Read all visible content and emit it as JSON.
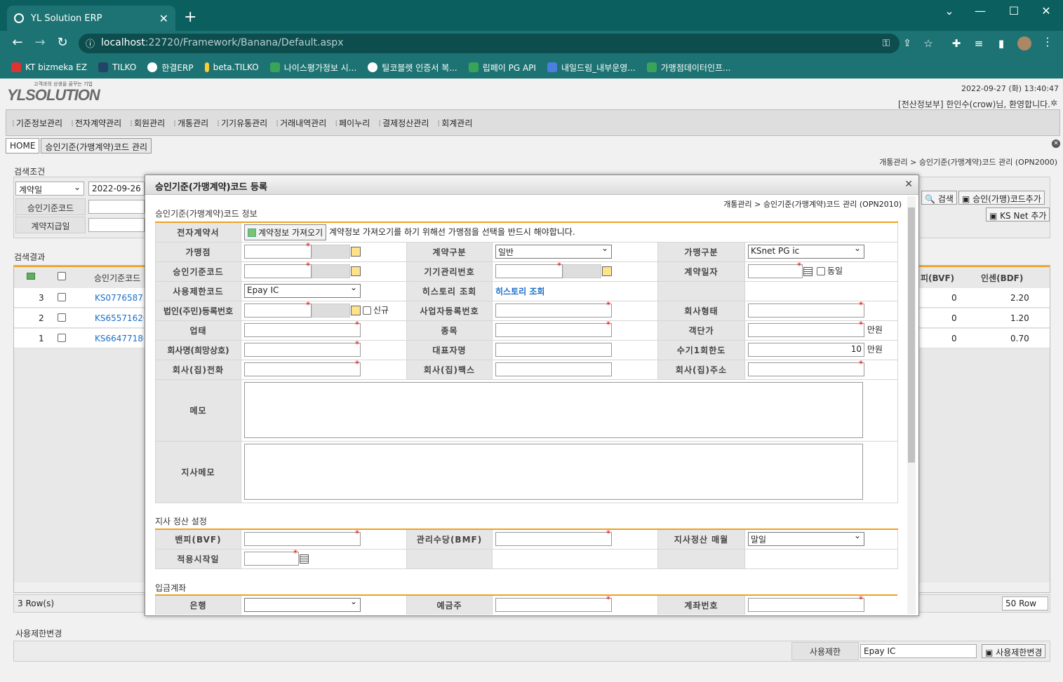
{
  "browser": {
    "tab_title": "YL Solution ERP",
    "url_host": "localhost",
    "url_path": ":22720/Framework/Banana/Default.aspx",
    "bookmarks": [
      "KT bizmeka EZ",
      "TILKO",
      "한결ERP",
      "beta.TILKO",
      "나이스평가정보 시...",
      "틸코블렛 인증서 복...",
      "립페이 PG API",
      "내일드림_내부운영...",
      "가맹점데이터인프..."
    ]
  },
  "app": {
    "logo_text": "YLSOLUTION",
    "logo_tagline": "고객과의 상생을 꿈꾸는 기업",
    "datetime": "2022-09-27 (화) 13:40:47",
    "welcome": "[전산정보부] 한인수(crow)님, 환영합니다.",
    "menu": [
      "기준정보관리",
      "전자계약관리",
      "회원관리",
      "개통관리",
      "기기유통관리",
      "거래내역관리",
      "페이누리",
      "결제정산관리",
      "회계관리"
    ],
    "tabs": [
      "HOME",
      "승인기준(가맹계약)코드 관리"
    ],
    "breadcrumb": "개통관리 > 승인기준(가맹계약)코드 관리 (OPN2000)"
  },
  "search": {
    "title": "검색조건",
    "date_type": "계약일",
    "date_from": "2022-09-26",
    "code_label": "승인기준코드",
    "pay_label": "계약지급일",
    "search_btn": "검색",
    "add_btn": "승인(가맹)코드추가",
    "ksnet_btn": "KS Net 추가"
  },
  "results": {
    "title": "검색결과",
    "col_code": "승인기준코드",
    "col_bvf": "피(BVF)",
    "col_bdf": "인센(BDF)",
    "rows": [
      {
        "no": "3",
        "code": "KS07765873",
        "bvf": "0",
        "bdf": "2.20"
      },
      {
        "no": "2",
        "code": "KS65571620",
        "bvf": "0",
        "bdf": "1.20"
      },
      {
        "no": "1",
        "code": "KS66477180",
        "bvf": "0",
        "bdf": "0.70"
      }
    ],
    "count": "3 Row(s)",
    "page_size": "50 Row"
  },
  "restrict": {
    "title": "사용제한변경",
    "label": "사용제한",
    "value": "Epay IC",
    "button": "사용제한변경"
  },
  "modal": {
    "title": "승인기준(가맹계약)코드 등록",
    "breadcrumb": "개통관리 > 승인기준(가맹계약)코드 관리 (OPN2010)",
    "section1": "승인기준(가맹계약)코드 정보",
    "econtract_label": "전자계약서",
    "import_btn": "계약정보 가져오기",
    "import_note": "계약정보 가져오기를 하기 위해선 가맹점을 선택을 반드시 해야합니다.",
    "labels": {
      "store": "가맹점",
      "contract_type": "계약구분",
      "store_type": "가맹구분",
      "approval_code": "승인기준코드",
      "device_no": "기기관리번호",
      "contract_date": "계약일자",
      "use_limit": "사용제한코드",
      "history": "히스토리 조회",
      "corp_no": "법인(주민)등록번호",
      "biz_no": "사업자등록번호",
      "company_type": "회사형태",
      "business": "업태",
      "item": "종목",
      "unit_price": "객단가",
      "company_name": "회사명(희망상호)",
      "ceo": "대표자명",
      "manual_limit": "수기1회한도",
      "phone": "회사(집)전화",
      "fax": "회사(집)팩스",
      "address": "회사(집)주소",
      "memo": "메모",
      "branch_memo": "지사메모"
    },
    "values": {
      "contract_type": "일반",
      "store_type": "KSnet PG ic",
      "use_limit": "Epay IC",
      "history_link": "히스토리 조회",
      "same_label": "동일",
      "new_label": "신규",
      "unit": "만원",
      "manual_limit": "10"
    },
    "section2": "지사 정산 설정",
    "settle": {
      "bvf_label": "밴피(BVF)",
      "bmf_label": "관리수당(BMF)",
      "monthly_label": "지사정산 매월",
      "monthly_value": "말일",
      "start_label": "적용시작일"
    },
    "section3": "입금계좌",
    "account": {
      "bank_label": "은행",
      "holder_label": "예금주",
      "account_label": "계좌번호"
    }
  }
}
